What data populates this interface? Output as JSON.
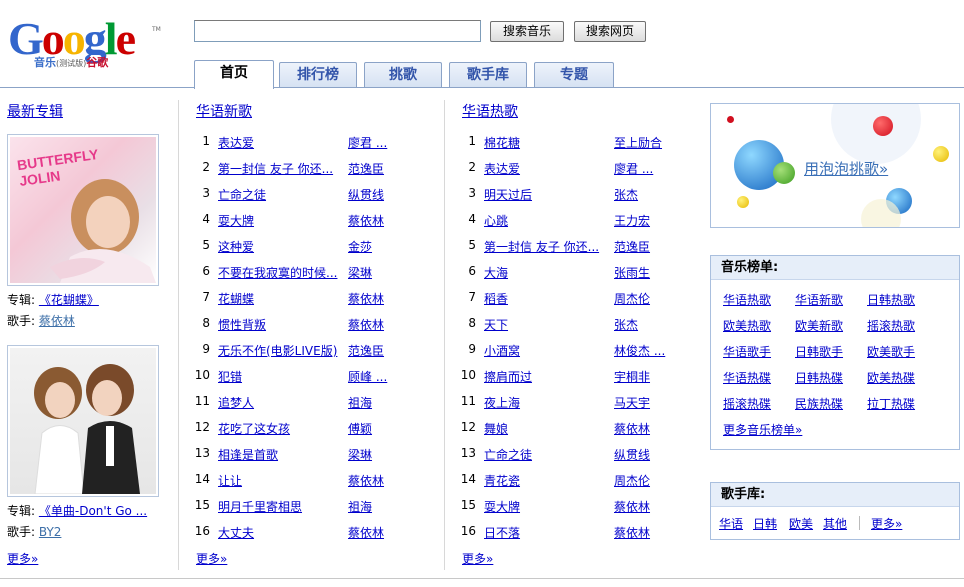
{
  "logo": {
    "letters": [
      "G",
      "o",
      "o",
      "g",
      "l",
      "e"
    ],
    "colors": [
      "#3366cc",
      "#cc0000",
      "#f6b400",
      "#3366cc",
      "#009933",
      "#cc0000"
    ],
    "sub_main": "音乐",
    "sub_small": "(测试版)",
    "sub_brand": "谷歌",
    "tm": "TM"
  },
  "search": {
    "value": "",
    "btn_music": "搜索音乐",
    "btn_web": "搜索网页"
  },
  "tabs": [
    "首页",
    "排行榜",
    "挑歌",
    "歌手库",
    "专题"
  ],
  "left": {
    "title": "最新专辑",
    "albums": [
      {
        "cover_text": "BUTTERFLY JOLIN",
        "album_label": "专辑:",
        "album_name": "《花蝴蝶》",
        "artist_label": "歌手:",
        "artist": "蔡依林"
      },
      {
        "cover_text": "",
        "album_label": "专辑:",
        "album_name": "《单曲-Don't Go ...",
        "artist_label": "歌手:",
        "artist": "BY2"
      }
    ],
    "more": "更多»"
  },
  "new_songs": {
    "title": "华语新歌",
    "rows": [
      {
        "n": "1",
        "song": "表达爱",
        "singer": "廖君 ..."
      },
      {
        "n": "2",
        "song": "第一封信 友子 你还...",
        "singer": "范逸臣"
      },
      {
        "n": "3",
        "song": "亡命之徒",
        "singer": "纵贯线"
      },
      {
        "n": "4",
        "song": "耍大牌",
        "singer": "蔡依林"
      },
      {
        "n": "5",
        "song": "这种爱",
        "singer": "金莎"
      },
      {
        "n": "6",
        "song": "不要在我寂寞的时候...",
        "singer": "梁琳"
      },
      {
        "n": "7",
        "song": "花蝴蝶",
        "singer": "蔡依林"
      },
      {
        "n": "8",
        "song": "惯性背叛",
        "singer": "蔡依林"
      },
      {
        "n": "9",
        "song": "无乐不作(电影LIVE版)",
        "singer": "范逸臣"
      },
      {
        "n": "10",
        "song": "犯错",
        "singer": "顾峰 ..."
      },
      {
        "n": "11",
        "song": "追梦人",
        "singer": "祖海"
      },
      {
        "n": "12",
        "song": "花吃了这女孩",
        "singer": "傅颖"
      },
      {
        "n": "13",
        "song": "相逢是首歌",
        "singer": "梁琳"
      },
      {
        "n": "14",
        "song": "让让",
        "singer": "蔡依林"
      },
      {
        "n": "15",
        "song": "明月千里寄相思",
        "singer": "祖海"
      },
      {
        "n": "16",
        "song": "大丈夫",
        "singer": "蔡依林"
      }
    ],
    "more": "更多»"
  },
  "hot_songs": {
    "title": "华语热歌",
    "rows": [
      {
        "n": "1",
        "song": "棉花糖",
        "singer": "至上励合"
      },
      {
        "n": "2",
        "song": "表达爱",
        "singer": "廖君 ..."
      },
      {
        "n": "3",
        "song": "明天过后",
        "singer": "张杰"
      },
      {
        "n": "4",
        "song": "心跳",
        "singer": "王力宏"
      },
      {
        "n": "5",
        "song": "第一封信 友子 你还...",
        "singer": "范逸臣"
      },
      {
        "n": "6",
        "song": "大海",
        "singer": "张雨生"
      },
      {
        "n": "7",
        "song": "稻香",
        "singer": "周杰伦"
      },
      {
        "n": "8",
        "song": "天下",
        "singer": "张杰"
      },
      {
        "n": "9",
        "song": "小酒窝",
        "singer": "林俊杰 ..."
      },
      {
        "n": "10",
        "song": "擦肩而过",
        "singer": "宇桐非"
      },
      {
        "n": "11",
        "song": "夜上海",
        "singer": "马天宇"
      },
      {
        "n": "12",
        "song": "舞娘",
        "singer": "蔡依林"
      },
      {
        "n": "13",
        "song": "亡命之徒",
        "singer": "纵贯线"
      },
      {
        "n": "14",
        "song": "青花瓷",
        "singer": "周杰伦"
      },
      {
        "n": "15",
        "song": "耍大牌",
        "singer": "蔡依林"
      },
      {
        "n": "16",
        "song": "日不落",
        "singer": "蔡依林"
      }
    ],
    "more": "更多»"
  },
  "bubble": {
    "link": "用泡泡挑歌»"
  },
  "charts_panel": {
    "title": "音乐榜单:",
    "links": [
      [
        "华语热歌",
        "华语新歌",
        "日韩热歌"
      ],
      [
        "欧美热歌",
        "欧美新歌",
        "摇滚热歌"
      ],
      [
        "华语歌手",
        "日韩歌手",
        "欧美歌手"
      ],
      [
        "华语热碟",
        "日韩热碟",
        "欧美热碟"
      ],
      [
        "摇滚热碟",
        "民族热碟",
        "拉丁热碟"
      ]
    ],
    "more": "更多音乐榜单»"
  },
  "artist_panel": {
    "title": "歌手库:",
    "links": [
      "华语",
      "日韩",
      "欧美",
      "其他"
    ],
    "more": "更多»"
  },
  "colors": {
    "link": "#0000cc",
    "tab_border": "#8ba3c7",
    "panel_head": "#e6eef9"
  }
}
